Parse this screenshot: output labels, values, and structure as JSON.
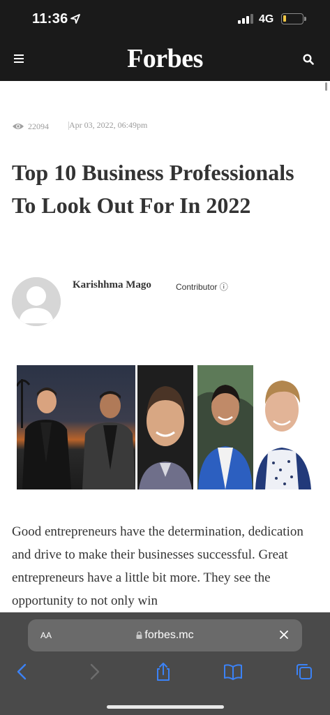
{
  "status_bar": {
    "time": "11:36",
    "network": "4G",
    "battery_level": 0.15,
    "battery_color": "#f2c744"
  },
  "header": {
    "brand": "Forbes",
    "background": "#1a1a1a"
  },
  "article": {
    "views": "22094",
    "date": "Apr 03, 2022, 06:49pm",
    "title": "Top 10 Business Professionals To Look Out For In 2022",
    "author": "Karishhma Mago",
    "role": "Contributor ⓘ",
    "body": "Good entrepreneurs have the determination, dedication and drive to make their businesses successful. Great entrepreneurs have a little bit more. They see the opportunity to not only win"
  },
  "browser": {
    "text_size_label": "AA",
    "url": "forbes.mc",
    "toolbar_icons": [
      "back-icon",
      "forward-icon",
      "share-icon",
      "bookmarks-icon",
      "tabs-icon"
    ],
    "accent": "#3b82f6"
  }
}
